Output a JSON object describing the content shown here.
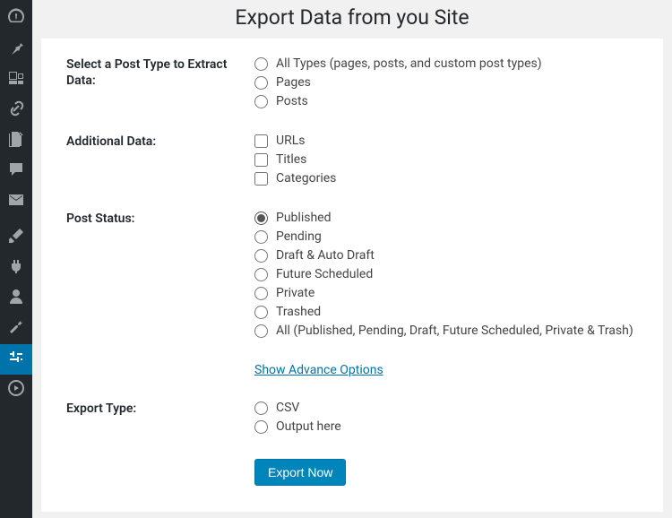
{
  "page": {
    "title": "Export Data from you Site"
  },
  "form": {
    "post_type": {
      "label": "Select a Post Type to Extract Data:",
      "options": [
        "All Types (pages, posts, and custom post types)",
        "Pages",
        "Posts"
      ]
    },
    "additional_data": {
      "label": "Additional Data:",
      "options": [
        "URLs",
        "Titles",
        "Categories"
      ]
    },
    "post_status": {
      "label": "Post Status:",
      "options": [
        "Published",
        "Pending",
        "Draft & Auto Draft",
        "Future Scheduled",
        "Private",
        "Trashed",
        "All (Published, Pending, Draft, Future Scheduled, Private & Trash)"
      ]
    },
    "advance_link": "Show Advance Options",
    "export_type": {
      "label": "Export Type:",
      "options": [
        "CSV",
        "Output here"
      ]
    },
    "submit_label": "Export Now"
  }
}
